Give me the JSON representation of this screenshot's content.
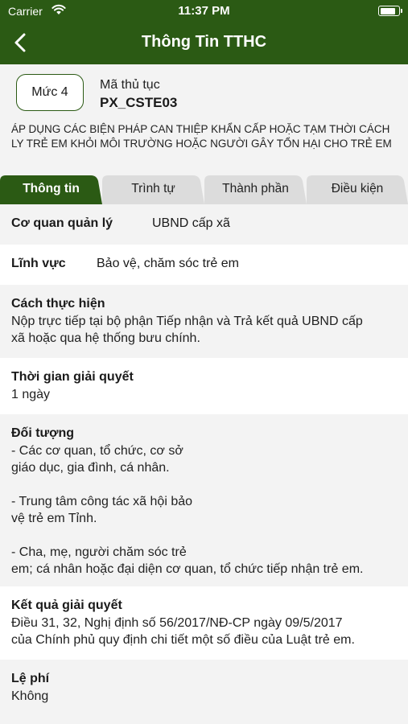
{
  "status_bar": {
    "carrier": "Carrier",
    "time": "11:37 PM",
    "battery_level": 0.9
  },
  "nav": {
    "title": "Thông Tin TTHC",
    "back_icon": "chevron-left-icon"
  },
  "header": {
    "level": "Mức 4",
    "code_label": "Mã thủ tục",
    "code_value": "PX_CSTE03",
    "procedure_name": "ÁP DỤNG CÁC BIỆN PHÁP CAN THIỆP KHẨN CẤP HOẶC TẠM THỜI CÁCH LY TRẺ EM KHỎI MÔI TRƯỜNG HOẶC NGƯỜI GÂY TỔN HẠI CHO TRẺ EM"
  },
  "tabs": [
    "Thông tin",
    "Trình tự",
    "Thành phần",
    "Điều kiện"
  ],
  "active_tab": "Thông tin",
  "colors": {
    "primary": "#2b5a14",
    "tab_inactive": "#dcdcdc",
    "section_gray": "#f3f3f3"
  },
  "fields": {
    "agency": {
      "label": "Cơ quan quản lý",
      "value": "UBND cấp xã"
    },
    "sector": {
      "label": "Lĩnh vực",
      "value": "Bảo vệ, chăm sóc trẻ em"
    },
    "method": {
      "label": "Cách thực hiện",
      "value": "Nộp trực tiếp tại bộ phận Tiếp nhận và Trả kết quả UBND cấp\nxã hoặc qua hệ thống bưu chính."
    },
    "duration": {
      "label": "Thời gian giải quyết",
      "value": "1 ngày"
    },
    "subjects": {
      "label": "Đối tượng",
      "value": "- Các cơ quan, tổ chức, cơ sở\ngiáo dục, gia đình, cá nhân.\n\n- Trung tâm công tác xã hội bảo\nvệ trẻ em Tỉnh.\n\n- Cha, mẹ, người chăm sóc trẻ\nem; cá nhân hoặc đại diện cơ quan, tổ chức tiếp nhận trẻ em."
    },
    "result": {
      "label": "Kết quả giải quyết",
      "value": "Điều 31, 32, Nghị định số 56/2017/NĐ-CP ngày 09/5/2017\ncủa Chính phủ quy định chi tiết một số điều của Luật trẻ em."
    },
    "fee": {
      "label": "Lệ phí",
      "value": "Không"
    }
  }
}
